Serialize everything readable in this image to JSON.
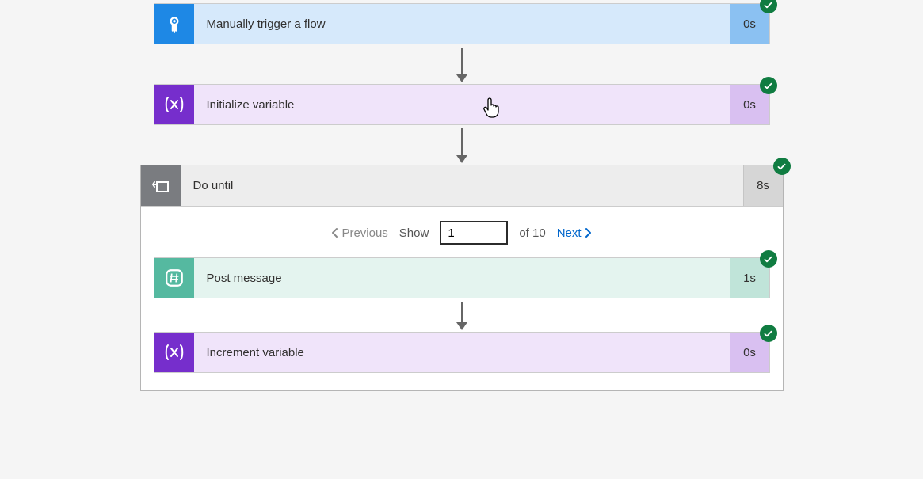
{
  "steps": {
    "trigger": {
      "title": "Manually trigger a flow",
      "duration": "0s"
    },
    "initVar": {
      "title": "Initialize variable",
      "duration": "0s"
    },
    "doUntil": {
      "title": "Do until",
      "duration": "8s"
    },
    "postMsg": {
      "title": "Post message",
      "duration": "1s"
    },
    "incVar": {
      "title": "Increment variable",
      "duration": "0s"
    }
  },
  "pager": {
    "previous_label": "Previous",
    "show_label": "Show",
    "current": "1",
    "of_label": "of 10",
    "next_label": "Next"
  }
}
